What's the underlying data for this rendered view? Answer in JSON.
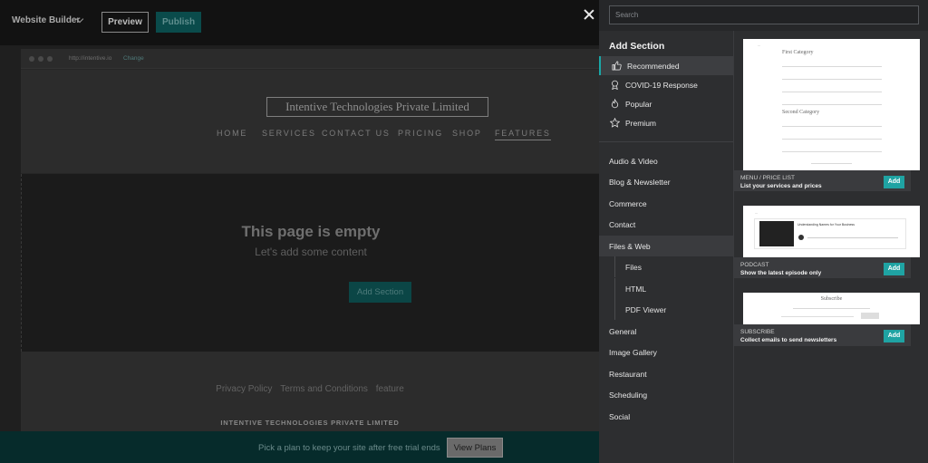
{
  "editor": {
    "brand": "Website Builder",
    "preview_label": "Preview",
    "publish_label": "Publish",
    "url": "http://intentive.io",
    "url_change": "Change",
    "site_title": "Intentive Technologies Private Limited",
    "nav": [
      "HOME",
      "SERVICES",
      "CONTACT US",
      "PRICING",
      "SHOP",
      "FEATURES"
    ],
    "empty_title": "This page is empty",
    "empty_subtitle": "Let's add some content",
    "add_section_label": "Add Section",
    "footer_links": [
      "Privacy Policy",
      "Terms and Conditions",
      "feature"
    ],
    "footer_company": "INTENTIVE TECHNOLOGIES PRIVATE LIMITED",
    "trial_text": "Pick a plan to keep your site after free trial ends",
    "view_plans_label": "View Plans"
  },
  "panel": {
    "search_placeholder": "Search",
    "heading": "Add Section",
    "recommended": [
      {
        "label": "Recommended",
        "icon": "thumbs-up-icon"
      },
      {
        "label": "COVID-19 Response",
        "icon": "ribbon-icon"
      },
      {
        "label": "Popular",
        "icon": "flame-icon"
      },
      {
        "label": "Premium",
        "icon": "star-icon"
      }
    ],
    "categories": [
      "Audio & Video",
      "Blog & Newsletter",
      "Commerce",
      "Contact",
      "Files & Web"
    ],
    "files_web_children": [
      "Files",
      "HTML",
      "PDF Viewer"
    ],
    "categories_after": [
      "General",
      "Image Gallery",
      "Restaurant",
      "Scheduling",
      "Social"
    ],
    "cards": [
      {
        "name": "MENU / PRICE LIST",
        "desc": "List your services and prices",
        "add_label": "Add",
        "preview": {
          "first_heading": "First Category",
          "second_heading": "Second Category"
        }
      },
      {
        "name": "PODCAST",
        "desc": "Show the latest episode only",
        "add_label": "Add",
        "preview": {
          "episode_title": "Understanding Names for Your Business"
        }
      },
      {
        "name": "SUBSCRIBE",
        "desc": "Collect emails to send newsletters",
        "add_label": "Add",
        "preview": {
          "title": "Subscribe"
        }
      }
    ]
  }
}
